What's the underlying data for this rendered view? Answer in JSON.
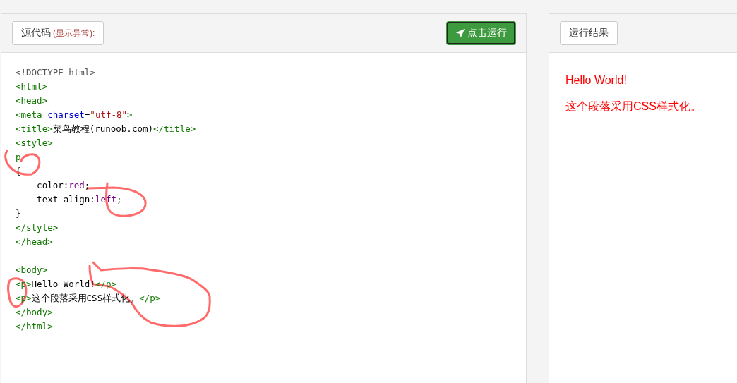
{
  "source_panel": {
    "label": "源代码",
    "label_note": "(显示异常):",
    "run_button": "点击运行"
  },
  "code_lines": [
    {
      "kind": "code",
      "tokens": [
        {
          "kind": "meta",
          "text": "<!DOCTYPE html>"
        }
      ]
    },
    {
      "kind": "code",
      "tokens": [
        {
          "kind": "tag",
          "text": "<html>"
        }
      ]
    },
    {
      "kind": "code",
      "tokens": [
        {
          "kind": "tag",
          "text": "<head>"
        }
      ]
    },
    {
      "kind": "code",
      "tokens": [
        {
          "kind": "tag",
          "text": "<meta"
        },
        {
          "kind": "attribute",
          "text": "charset"
        },
        {
          "kind": "text",
          "text": "="
        },
        {
          "kind": "string",
          "text": "\"utf-8\""
        },
        {
          "kind": "tag",
          "text": ">"
        }
      ]
    },
    {
      "kind": "code",
      "tokens": [
        {
          "kind": "tag",
          "text": "<title>"
        },
        {
          "kind": "text",
          "text": "菜鸟教程(runoob.com)"
        },
        {
          "kind": "tag",
          "text": "</title>"
        }
      ]
    },
    {
      "kind": "code",
      "tokens": [
        {
          "kind": "tag",
          "text": "<style>"
        }
      ]
    },
    {
      "kind": "code",
      "tokens": [
        {
          "kind": "tag",
          "text": "p"
        }
      ]
    },
    {
      "kind": "code",
      "tokens": [
        {
          "kind": "bracket",
          "text": "{"
        }
      ]
    },
    {
      "kind": "code",
      "tokens": [
        {
          "kind": "text",
          "text": "    color:"
        },
        {
          "kind": "keyword",
          "text": "red"
        },
        {
          "kind": "text",
          "text": ";"
        }
      ]
    },
    {
      "kind": "code",
      "tokens": [
        {
          "kind": "text",
          "text": "    text-align:"
        },
        {
          "kind": "keyword",
          "text": "left"
        },
        {
          "kind": "text",
          "text": ";"
        }
      ]
    },
    {
      "kind": "code",
      "tokens": [
        {
          "kind": "bracket",
          "text": "}"
        }
      ]
    },
    {
      "kind": "code",
      "tokens": [
        {
          "kind": "tag",
          "text": "</style>"
        }
      ]
    },
    {
      "kind": "code",
      "tokens": [
        {
          "kind": "tag",
          "text": "</head>"
        }
      ]
    },
    {
      "kind": "blank"
    },
    {
      "kind": "code",
      "tokens": [
        {
          "kind": "tag",
          "text": "<body>"
        }
      ]
    },
    {
      "kind": "code",
      "tokens": [
        {
          "kind": "tag",
          "text": "<p>"
        },
        {
          "kind": "text",
          "text": "Hello World!"
        },
        {
          "kind": "tag",
          "text": "</p>"
        }
      ]
    },
    {
      "kind": "code",
      "tokens": [
        {
          "kind": "tag",
          "text": "<p>"
        },
        {
          "kind": "text",
          "text": "这个段落采用CSS样式化。"
        },
        {
          "kind": "tag",
          "text": "</p>"
        }
      ]
    },
    {
      "kind": "code",
      "tokens": [
        {
          "kind": "tag",
          "text": "</body>"
        }
      ]
    },
    {
      "kind": "code",
      "tokens": [
        {
          "kind": "tag",
          "text": "</html>"
        }
      ]
    }
  ],
  "result_panel": {
    "label": "运行结果",
    "output": [
      "Hello World!",
      "这个段落采用CSS样式化。"
    ]
  }
}
